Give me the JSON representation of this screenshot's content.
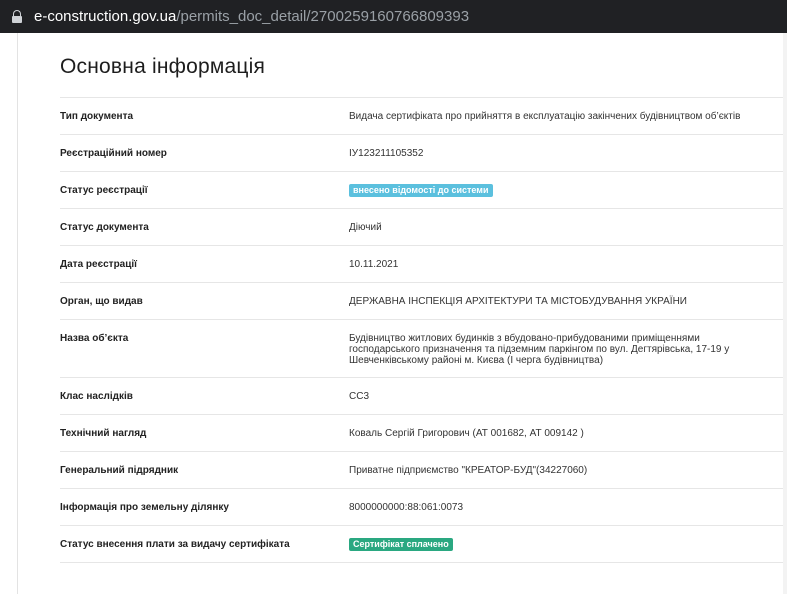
{
  "browser": {
    "url_host": "e-construction.gov.ua",
    "url_path": "/permits_doc_detail/2700259160766809393"
  },
  "page": {
    "title": "Основна інформація"
  },
  "rows": [
    {
      "label": "Тип документа",
      "value": "Видача сертифіката про прийняття в експлуатацію закінчених будівництвом об’єктів"
    },
    {
      "label": "Реєстраційний номер",
      "value": "ІУ123211105352"
    },
    {
      "label": "Статус реєстрації",
      "value": "внесено відомості до системи"
    },
    {
      "label": "Статус документа",
      "value": "Діючий"
    },
    {
      "label": "Дата реєстрації",
      "value": "10.11.2021"
    },
    {
      "label": "Орган, що видав",
      "value": "ДЕРЖАВНА ІНСПЕКЦІЯ АРХІТЕКТУРИ ТА МІСТОБУДУВАННЯ УКРАЇНИ"
    },
    {
      "label": "Назва об’єкта",
      "value": "Будівництво житлових будинків з вбудовано-прибудованими приміщеннями господарського призначення та підземним паркінгом по вул. Дегтярівська, 17-19 у Шевченківському районі м. Києва (І черга будівництва)"
    },
    {
      "label": "Клас наслідків",
      "value": "СС3"
    },
    {
      "label": "Технічний нагляд",
      "value": "Коваль Сергій Григорович (АТ 001682, АТ 009142 )"
    },
    {
      "label": "Генеральний підрядник",
      "value": "Приватне підприємство \"КРЕАТОР-БУД\"(34227060)"
    },
    {
      "label": "Інформація про земельну ділянку",
      "value": "8000000000:88:061:0073"
    },
    {
      "label": "Статус внесення плати за видачу сертифіката",
      "value": "Сертифікат сплачено"
    }
  ],
  "colors": {
    "registration_badge": "#5bc0de",
    "payment_badge": "#2aa881"
  }
}
